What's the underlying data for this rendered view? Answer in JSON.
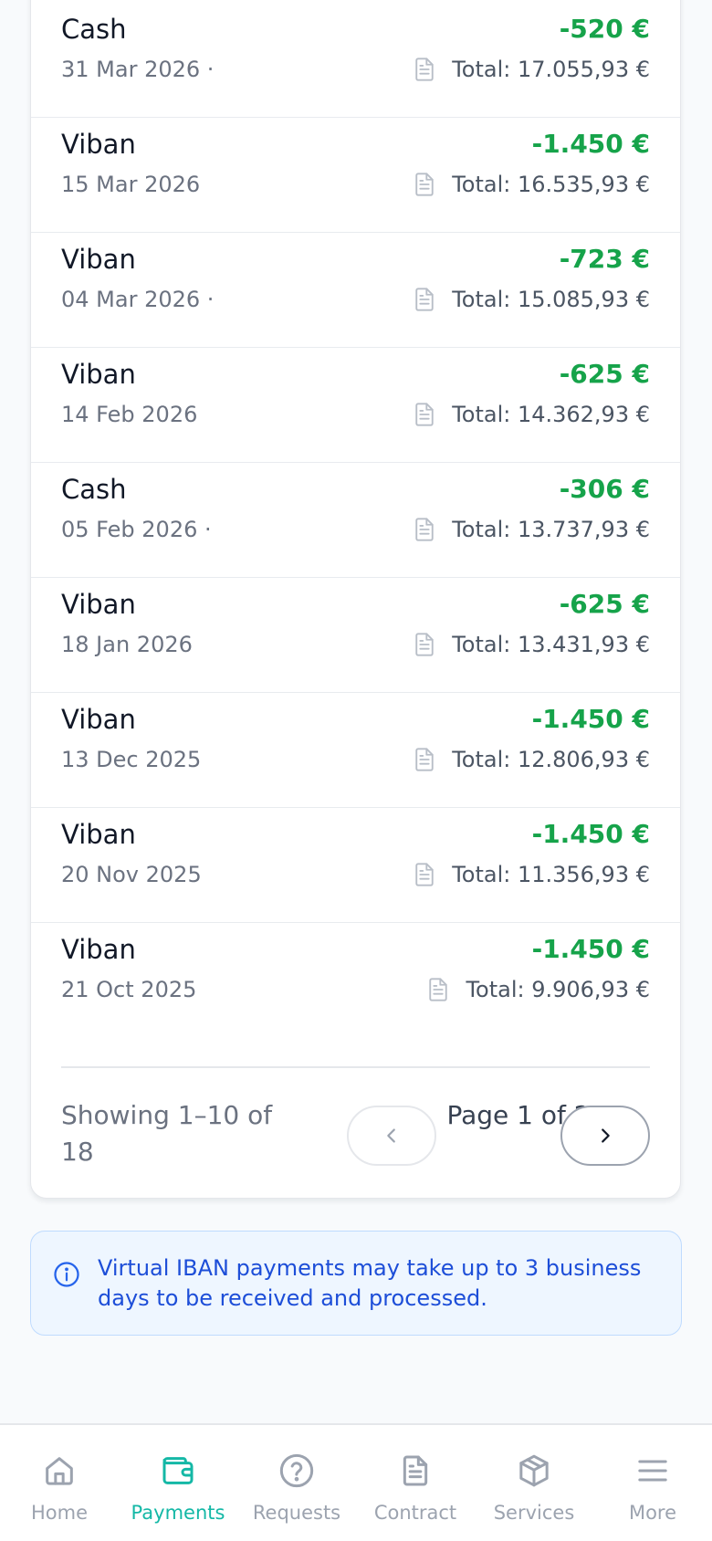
{
  "payments": [
    {
      "method": "Cash",
      "date": "31 Mar 2026 ·",
      "amount": "-520 €",
      "total": "Total: 17.055,93 €"
    },
    {
      "method": "Viban",
      "date": "15 Mar 2026",
      "amount": "-1.450 €",
      "total": "Total: 16.535,93 €"
    },
    {
      "method": "Viban",
      "date": "04 Mar 2026 ·",
      "amount": "-723 €",
      "total": "Total: 15.085,93 €"
    },
    {
      "method": "Viban",
      "date": "14 Feb 2026",
      "amount": "-625 €",
      "total": "Total: 14.362,93 €"
    },
    {
      "method": "Cash",
      "date": "05 Feb 2026 ·",
      "amount": "-306 €",
      "total": "Total: 13.737,93 €"
    },
    {
      "method": "Viban",
      "date": "18 Jan 2026",
      "amount": "-625 €",
      "total": "Total: 13.431,93 €"
    },
    {
      "method": "Viban",
      "date": "13 Dec 2025",
      "amount": "-1.450 €",
      "total": "Total: 12.806,93 €"
    },
    {
      "method": "Viban",
      "date": "20 Nov 2025",
      "amount": "-1.450 €",
      "total": "Total: 11.356,93 €"
    },
    {
      "method": "Viban",
      "date": "21 Oct 2025",
      "amount": "-1.450 €",
      "total": "Total: 9.906,93 €"
    }
  ],
  "pagination": {
    "showing": "Showing 1–10 of 18",
    "page": "Page 1 of 2",
    "prev_icon": "chevron-left-icon",
    "next_icon": "chevron-right-icon"
  },
  "notice": {
    "text": "Virtual IBAN payments may take up to 3 business days to be received and processed.",
    "icon": "info-icon"
  },
  "nav": [
    {
      "label": "Home",
      "icon": "home-icon",
      "active": false
    },
    {
      "label": "Payments",
      "icon": "wallet-icon",
      "active": true
    },
    {
      "label": "Requests",
      "icon": "question-icon",
      "active": false
    },
    {
      "label": "Contract",
      "icon": "document-icon",
      "active": false
    },
    {
      "label": "Services",
      "icon": "box-icon",
      "active": false
    },
    {
      "label": "More",
      "icon": "menu-icon",
      "active": false
    }
  ],
  "colors": {
    "amount": "#16a34a",
    "accent": "#14b8a6",
    "notice_text": "#1d4ed8",
    "notice_bg": "#eef6ff"
  }
}
